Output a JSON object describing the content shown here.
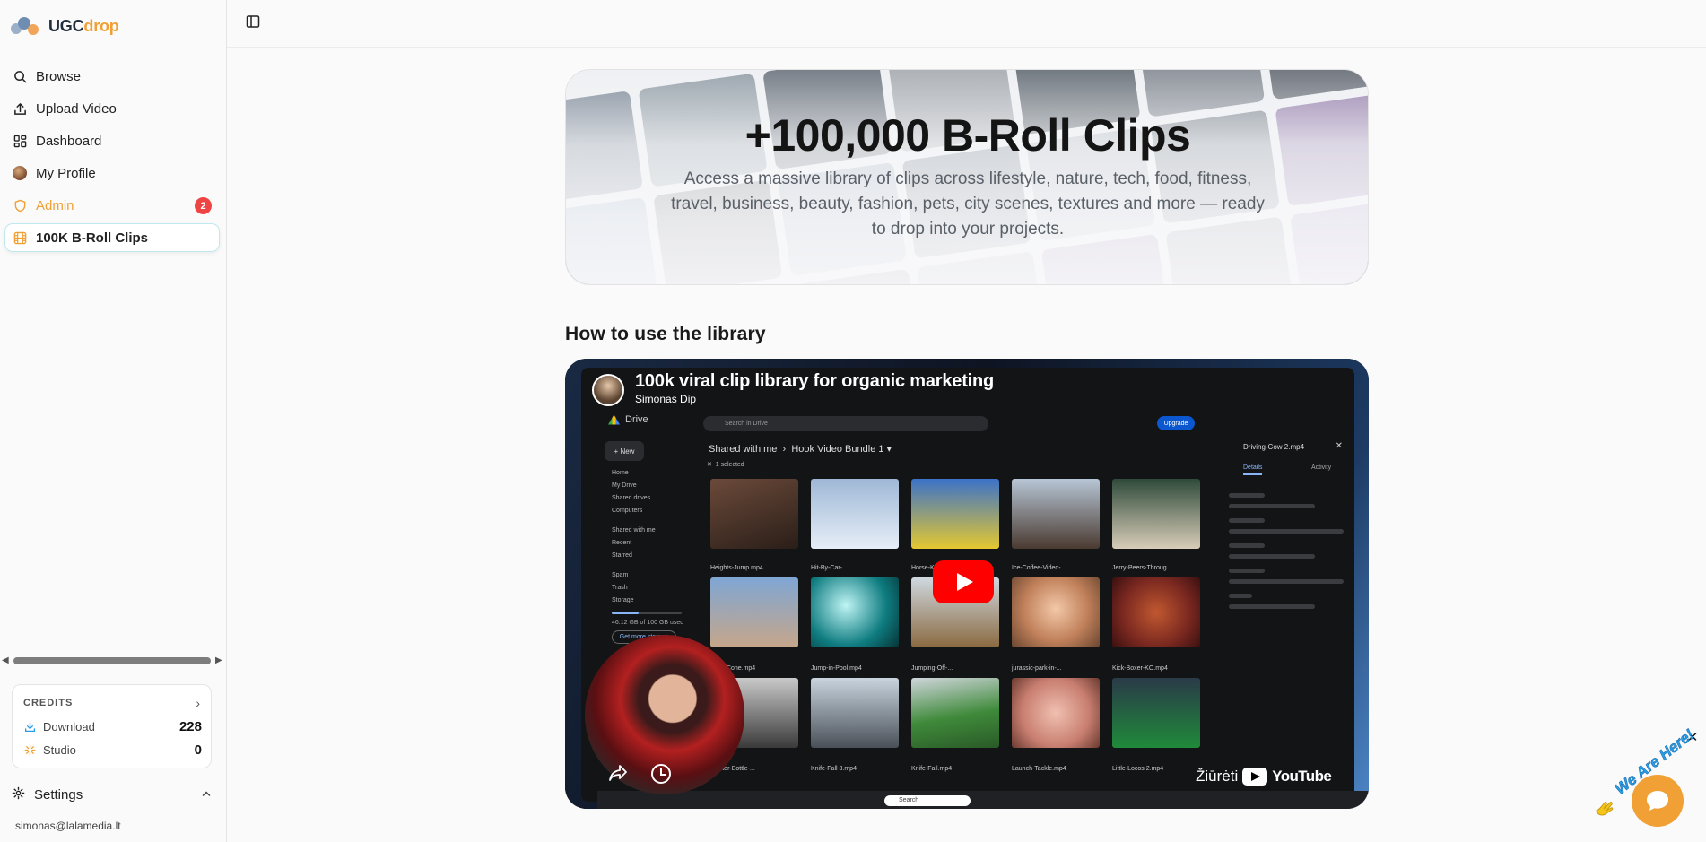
{
  "app": {
    "logo_primary": "UGC",
    "logo_accent": "drop",
    "brand_accent_color": "#f0a034"
  },
  "sidebar": {
    "items": [
      {
        "label": "Browse",
        "icon": "search-icon"
      },
      {
        "label": "Upload Video",
        "icon": "upload-icon"
      },
      {
        "label": "Dashboard",
        "icon": "dashboard-icon"
      },
      {
        "label": "My Profile",
        "icon": "avatar"
      },
      {
        "label": "Admin",
        "icon": "shield-icon",
        "badge": "2"
      },
      {
        "label": "100K B-Roll Clips",
        "icon": "film-icon",
        "active": true
      }
    ],
    "credits": {
      "heading": "CREDITS",
      "rows": [
        {
          "label": "Download",
          "value": "228",
          "icon": "download-icon"
        },
        {
          "label": "Studio",
          "value": "0",
          "icon": "sparkle-icon"
        }
      ]
    },
    "settings_label": "Settings",
    "user_email": "simonas@lalamedia.lt"
  },
  "hero": {
    "title": "+100,000 B-Roll Clips",
    "subtitle": "Access a massive library of clips across lifestyle, nature, tech, food, fitness, travel, business, beauty, fashion, pets, city scenes, textures and more — ready to drop into your projects."
  },
  "section": {
    "title": "How to use the library"
  },
  "video": {
    "title": "100k viral clip library for organic marketing",
    "channel": "Simonas Dip",
    "watch_label": "Žiūrėti",
    "youtube_word": "YouTube",
    "drive": {
      "app_name": "Drive",
      "new_label": "New",
      "search_placeholder": "Search in Drive",
      "upgrade_label": "Upgrade",
      "breadcrumb_root": "Shared with me",
      "breadcrumb_folder": "Hook Video Bundle 1",
      "selected_text": "1 selected",
      "nav": [
        "Home",
        "My Drive",
        "Shared drives",
        "Computers",
        "Shared with me",
        "Recent",
        "Starred",
        "Spam",
        "Trash",
        "Storage"
      ],
      "storage_text": "46.12 GB of 100 GB used",
      "more_storage": "Get more storage",
      "file_rows": [
        [
          "",
          "",
          "",
          "",
          ""
        ],
        [
          "Heights-Jump.mp4",
          "Hit-By-Car-...",
          "Horse-Kicks-...",
          "Ice-Coffee-Video-...",
          "Jerry-Peers-Throug..."
        ],
        [
          "...mp-Cone.mp4",
          "Jump-in-Pool.mp4",
          "Jumping-Off-...",
          "jurassic-park-in-...",
          "Kick-Boxer-KO.mp4"
        ],
        [
          "...nster-Bottle-...",
          "Knife-Fall 3.mp4",
          "Knife-Fall.mp4",
          "Launch-Tackle.mp4",
          "Little-Locos 2.mp4"
        ]
      ],
      "details_file": "Driving-Cow 2.mp4",
      "details_tab": "Details",
      "activity_tab": "Activity",
      "taskbar_search": "Search"
    }
  },
  "chat_widget": {
    "tagline": "We Are Here!"
  }
}
